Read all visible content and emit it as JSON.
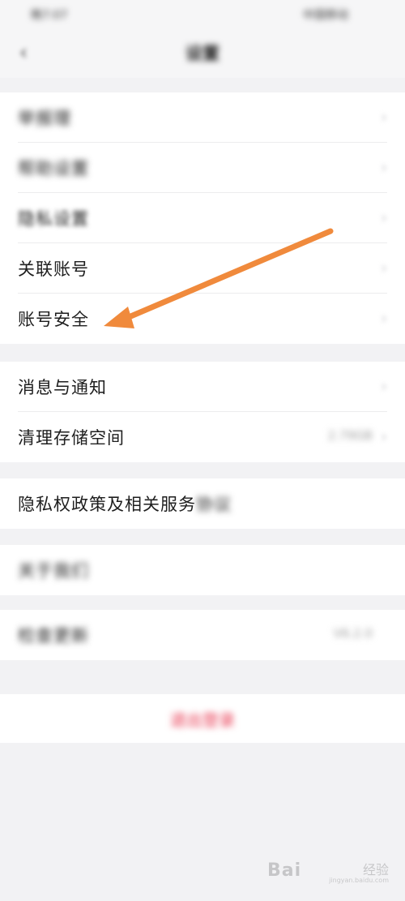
{
  "status_bar": {
    "left": "晚7:07",
    "right": "中国移动"
  },
  "nav": {
    "title": "设置",
    "back_icon": "chevron-left-icon"
  },
  "groups": [
    {
      "items": [
        {
          "label": "举报理",
          "blurred": true
        },
        {
          "label": "帮助设置",
          "blurred": true
        },
        {
          "label": "隐私设置",
          "blurred": true
        },
        {
          "label": "关联账号",
          "blurred": false
        },
        {
          "label": "账号安全",
          "blurred": false
        }
      ]
    },
    {
      "items": [
        {
          "label": "消息与通知",
          "blurred": false
        },
        {
          "label": "清理存储空间",
          "blurred": false,
          "value": "2.79GB"
        }
      ]
    },
    {
      "items": [
        {
          "label": "隐私权政策及相关服务",
          "suffix": "协议"
        }
      ]
    },
    {
      "items": [
        {
          "label": "关于我们",
          "blurred": true
        }
      ]
    },
    {
      "items": [
        {
          "label": "检查更新",
          "blurred": true,
          "value": "V6.2.0"
        }
      ]
    }
  ],
  "logout": {
    "label": "退出登录"
  },
  "annotation": {
    "arrow_color": "#f08a3c",
    "target": "账号安全"
  },
  "watermark": {
    "text": "Bai",
    "text2": "经验",
    "url": "jingyan.baidu.com"
  },
  "colors": {
    "background": "#f2f2f4",
    "logout": "#e8364f",
    "label": "#1e1e1e"
  }
}
